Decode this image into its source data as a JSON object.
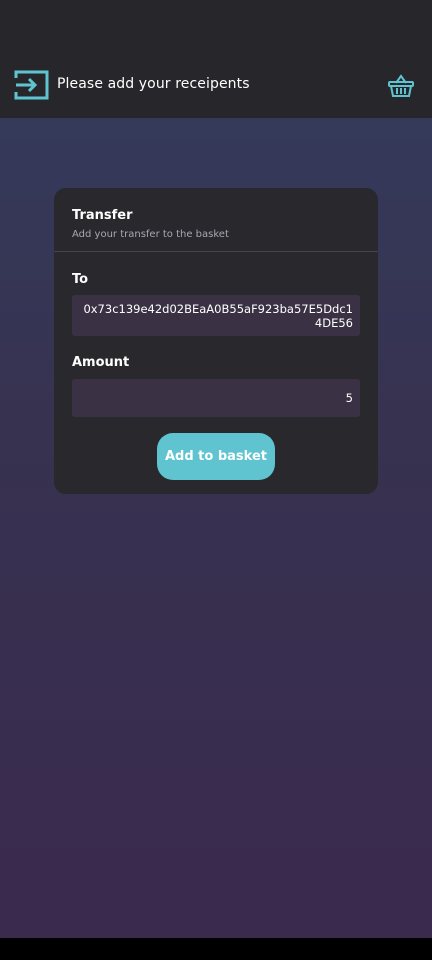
{
  "header": {
    "title": "Please add your receipents",
    "exit_icon": "exit-to-app-icon",
    "basket_icon": "basket-icon"
  },
  "card": {
    "title": "Transfer",
    "subtitle": "Add your transfer to the basket",
    "to_label": "To",
    "to_value": "0x73c139e42d02BEaA0B55aF923ba57E5Ddc14DE56",
    "amount_label": "Amount",
    "amount_value": "5",
    "button_label": "Add to basket"
  },
  "colors": {
    "accent": "#5fc4d0",
    "topbar": "#27272b",
    "card": "#29282d",
    "input": "#3a3244"
  }
}
